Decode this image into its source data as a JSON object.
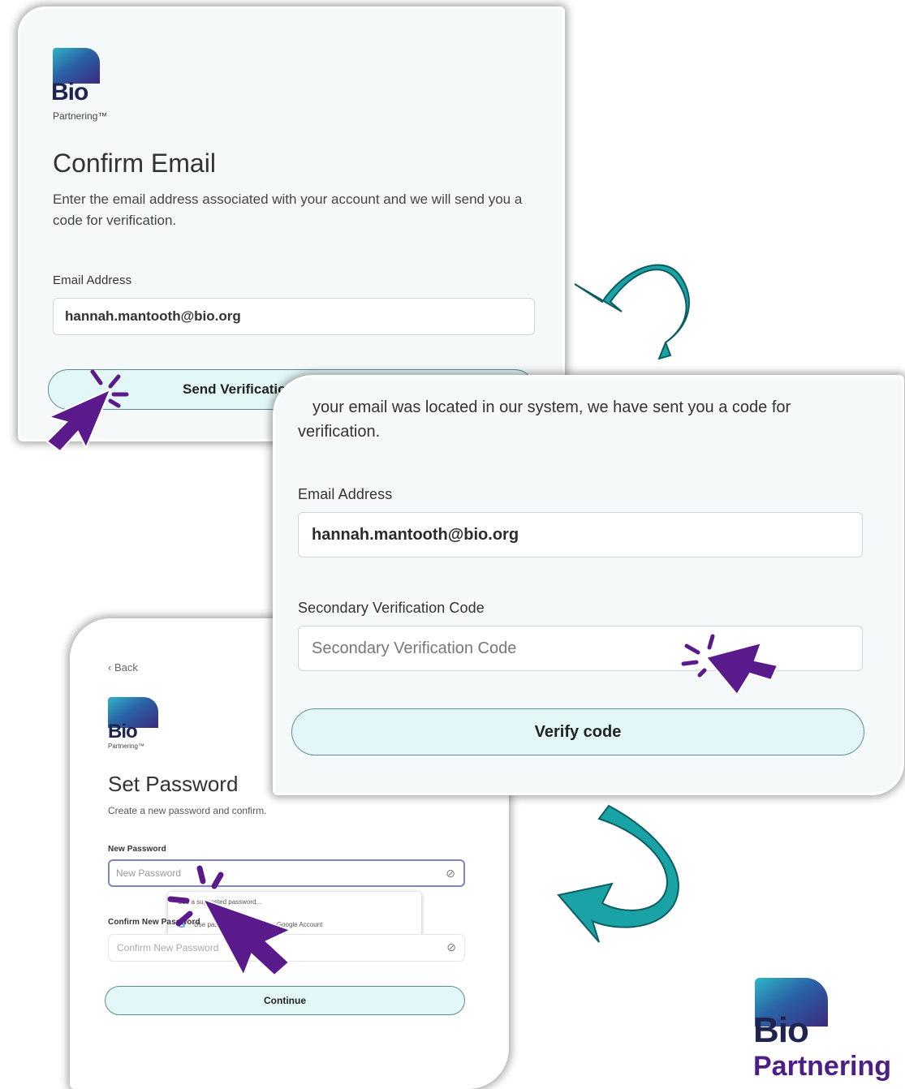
{
  "logo": {
    "brand": "Bio",
    "tagline": "Partnering™",
    "tagline_plain": "Partnering"
  },
  "confirm_email": {
    "title": "Confirm Email",
    "description": "Enter the email address associated with your account and we will send you a code for verification.",
    "email_label": "Email Address",
    "email_value": "hannah.mantooth@bio.org",
    "send_button": "Send Verification Code"
  },
  "verify": {
    "message": "your email was located in our system, we have sent you a code for verification.",
    "email_label": "Email Address",
    "email_value": "hannah.mantooth@bio.org",
    "code_label": "Secondary Verification Code",
    "code_placeholder": "Secondary Verification Code",
    "verify_button": "Verify code"
  },
  "set_password": {
    "back": "Back",
    "title": "Set Password",
    "description": "Create a new password and confirm.",
    "new_label": "New Password",
    "new_placeholder": "New Password",
    "confirm_label": "Confirm New Password",
    "confirm_placeholder": "Confirm New Password",
    "autofill_title": "Use a suggested password...",
    "autofill_text": "Use passkeys saved in your Google Account",
    "continue_button": "Continue"
  },
  "colors": {
    "arrow": "#1aa3a6",
    "cursor": "#5a1a8c",
    "button_bg": "#e3f7f8"
  }
}
